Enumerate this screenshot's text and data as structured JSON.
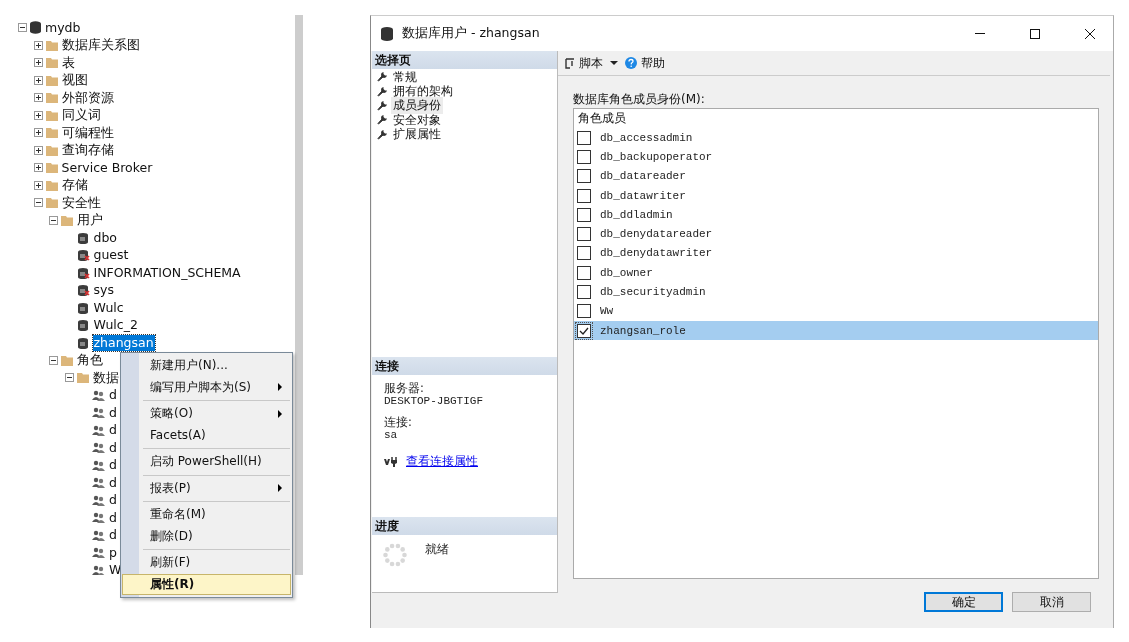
{
  "tree": {
    "items": [
      {
        "label": "mydb",
        "kind": "database",
        "expanded": true,
        "children": [
          {
            "label": "数据库关系图",
            "kind": "folder",
            "expanded": false
          },
          {
            "label": "表",
            "kind": "folder",
            "expanded": false
          },
          {
            "label": "视图",
            "kind": "folder",
            "expanded": false
          },
          {
            "label": "外部资源",
            "kind": "folder",
            "expanded": false
          },
          {
            "label": "同义词",
            "kind": "folder",
            "expanded": false
          },
          {
            "label": "可编程性",
            "kind": "folder",
            "expanded": false
          },
          {
            "label": "查询存储",
            "kind": "folder",
            "expanded": false
          },
          {
            "label": "Service Broker",
            "kind": "folder",
            "expanded": false
          },
          {
            "label": "存储",
            "kind": "folder",
            "expanded": false
          },
          {
            "label": "安全性",
            "kind": "folder",
            "expanded": true,
            "children": [
              {
                "label": "用户",
                "kind": "folder",
                "expanded": true,
                "children": [
                  {
                    "label": "dbo",
                    "kind": "user",
                    "disabled": false,
                    "selected": false
                  },
                  {
                    "label": "guest",
                    "kind": "user",
                    "disabled": true,
                    "selected": false
                  },
                  {
                    "label": "INFORMATION_SCHEMA",
                    "kind": "user",
                    "disabled": true,
                    "selected": false
                  },
                  {
                    "label": "sys",
                    "kind": "user",
                    "disabled": true,
                    "selected": false
                  },
                  {
                    "label": "Wulc",
                    "kind": "user",
                    "disabled": false,
                    "selected": false
                  },
                  {
                    "label": "Wulc_2",
                    "kind": "user",
                    "disabled": false,
                    "selected": false
                  },
                  {
                    "label": "zhangsan",
                    "kind": "user",
                    "disabled": false,
                    "selected": true
                  }
                ]
              },
              {
                "label": "角色",
                "kind": "folder",
                "expanded": true,
                "children": [
                  {
                    "label": "数据",
                    "kind": "folder",
                    "expanded": true,
                    "children": [
                      {
                        "label": "d",
                        "kind": "role"
                      },
                      {
                        "label": "d",
                        "kind": "role"
                      },
                      {
                        "label": "d",
                        "kind": "role"
                      },
                      {
                        "label": "d",
                        "kind": "role"
                      },
                      {
                        "label": "d",
                        "kind": "role"
                      },
                      {
                        "label": "d",
                        "kind": "role"
                      },
                      {
                        "label": "d",
                        "kind": "role"
                      },
                      {
                        "label": "d",
                        "kind": "role"
                      },
                      {
                        "label": "d",
                        "kind": "role"
                      },
                      {
                        "label": "p",
                        "kind": "role"
                      },
                      {
                        "label": "W",
                        "kind": "role"
                      }
                    ]
                  }
                ]
              }
            ]
          }
        ]
      }
    ]
  },
  "context_menu": {
    "groups": [
      [
        {
          "label": "新建用户(N)...",
          "submenu": false,
          "selected": false
        },
        {
          "label": "编写用户脚本为(S)",
          "submenu": true,
          "selected": false
        }
      ],
      [
        {
          "label": "策略(O)",
          "submenu": true,
          "selected": false
        },
        {
          "label": "Facets(A)",
          "submenu": false,
          "selected": false
        }
      ],
      [
        {
          "label": "启动 PowerShell(H)",
          "submenu": false,
          "selected": false
        }
      ],
      [
        {
          "label": "报表(P)",
          "submenu": true,
          "selected": false
        }
      ],
      [
        {
          "label": "重命名(M)",
          "submenu": false,
          "selected": false
        },
        {
          "label": "删除(D)",
          "submenu": false,
          "selected": false
        }
      ],
      [
        {
          "label": "刷新(F)",
          "submenu": false,
          "selected": false
        },
        {
          "label": "属性(R)",
          "submenu": false,
          "selected": true
        }
      ]
    ]
  },
  "dialog": {
    "title": "数据库用户 - zhangsan",
    "pages": {
      "header": "选择页",
      "items": [
        {
          "label": "常规",
          "selected": false
        },
        {
          "label": "拥有的架构",
          "selected": false
        },
        {
          "label": "成员身份",
          "selected": true
        },
        {
          "label": "安全对象",
          "selected": false
        },
        {
          "label": "扩展属性",
          "selected": false
        }
      ]
    },
    "connection": {
      "header": "连接",
      "server_label": "服务器:",
      "server": "DESKTOP-JBGTIGF",
      "connection_label": "连接:",
      "connection": "sa",
      "link": "查看连接属性"
    },
    "progress": {
      "header": "进度",
      "status": "就绪"
    },
    "toolbar": {
      "script": "脚本",
      "help": "帮助"
    },
    "roles": {
      "label": "数据库角色成员身份(M):",
      "column": "角色成员",
      "items": [
        {
          "name": "db_accessadmin",
          "checked": false,
          "selected": false
        },
        {
          "name": "db_backupoperator",
          "checked": false,
          "selected": false
        },
        {
          "name": "db_datareader",
          "checked": false,
          "selected": false
        },
        {
          "name": "db_datawriter",
          "checked": false,
          "selected": false
        },
        {
          "name": "db_ddladmin",
          "checked": false,
          "selected": false
        },
        {
          "name": "db_denydatareader",
          "checked": false,
          "selected": false
        },
        {
          "name": "db_denydatawriter",
          "checked": false,
          "selected": false
        },
        {
          "name": "db_owner",
          "checked": false,
          "selected": false
        },
        {
          "name": "db_securityadmin",
          "checked": false,
          "selected": false
        },
        {
          "name": "Ww",
          "checked": false,
          "selected": false
        },
        {
          "name": "zhangsan_role",
          "checked": true,
          "selected": true
        }
      ]
    },
    "buttons": [
      {
        "label": "确定",
        "default": true
      },
      {
        "label": "取消",
        "default": false
      }
    ]
  }
}
